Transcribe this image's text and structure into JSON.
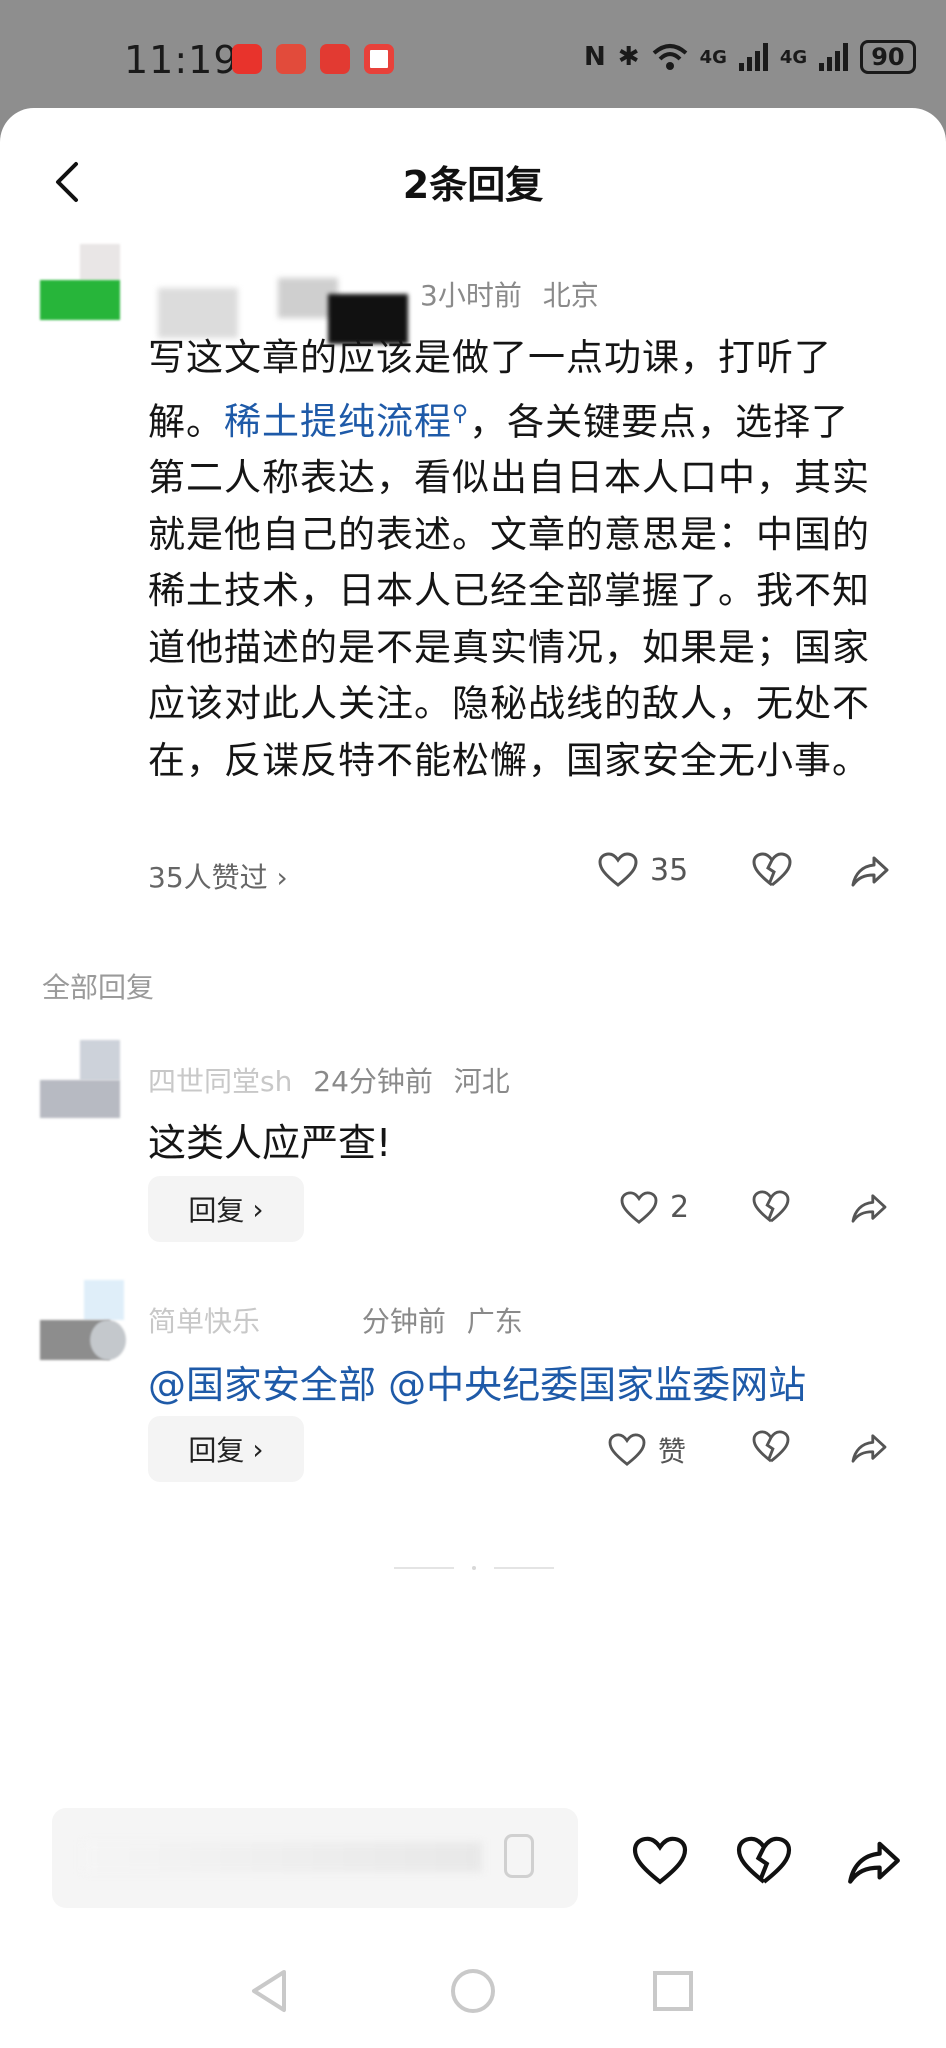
{
  "status_bar": {
    "time": "11:19",
    "network_1": "4G",
    "network_2": "4G",
    "battery": "90",
    "app_colors": [
      "#e8332c",
      "#e24b3b",
      "#e23a32",
      "#e8413a"
    ]
  },
  "header": {
    "title": "2条回复",
    "back_icon": "back-arrow-icon"
  },
  "main_comment": {
    "time": "3小时前",
    "location": "北京",
    "text_before_link": "写这文章的应该是做了一点功课，打听了解。",
    "link_text": "稀土提纯流程",
    "link_icon": "search-icon",
    "text_after_link": "，各关键要点，选择了第二人称表达，看似出自日本人口中，其实就是他自己的表述。文章的意思是：中国的稀土技术，日本人已经全部掌握了。我不知道他描述的是不是真实情况，如果是；国家应该对此人关注。隐秘战线的敌人，无处不在，反谍反特不能松懈，国家安全无小事。",
    "likers": "35人赞过",
    "likers_chevron": "›",
    "like_count": "35"
  },
  "section": {
    "label": "全部回复"
  },
  "replies": [
    {
      "name": "四世同堂sh",
      "time": "24分钟前",
      "location": "河北",
      "text": "这类人应严查!",
      "reply_label": "回复",
      "like_count": "2"
    },
    {
      "name": "简单快乐",
      "time": "分钟前",
      "location": "广东",
      "mention_1": "@国家安全部",
      "mention_2": "@中央纪委国家监委网站",
      "reply_label": "回复",
      "like_label": "赞"
    }
  ],
  "bottom_bar": {
    "like_icon": "heart-icon",
    "dislike_icon": "broken-heart-icon",
    "share_icon": "share-icon"
  },
  "colors": {
    "link": "#1e5aa8",
    "meta": "#8a8a8a",
    "text": "#151515"
  }
}
